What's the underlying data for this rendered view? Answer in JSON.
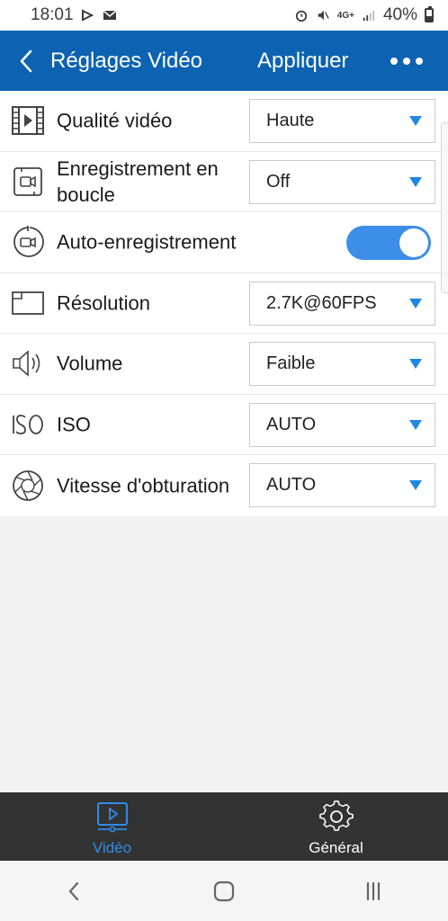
{
  "status_bar": {
    "time": "18:01",
    "battery": "40%",
    "network": "4G+"
  },
  "header": {
    "title": "Réglages Vidéo",
    "apply_label": "Appliquer"
  },
  "settings": [
    {
      "label": "Qualité vidéo",
      "value": "Haute",
      "icon": "film-icon",
      "control": "dropdown"
    },
    {
      "label": "Enregistrement en boucle",
      "value": "Off",
      "icon": "loop-record-icon",
      "control": "dropdown"
    },
    {
      "label": "Auto-enregistrement",
      "value": "on",
      "icon": "auto-record-icon",
      "control": "toggle"
    },
    {
      "label": "Résolution",
      "value": "2.7K@60FPS",
      "icon": "resolution-icon",
      "control": "dropdown"
    },
    {
      "label": "Volume",
      "value": "Faible",
      "icon": "speaker-icon",
      "control": "dropdown"
    },
    {
      "label": "ISO",
      "value": "AUTO",
      "icon": "iso-icon",
      "control": "dropdown"
    },
    {
      "label": "Vitesse d'obturation",
      "value": "AUTO",
      "icon": "shutter-icon",
      "control": "dropdown"
    }
  ],
  "tabs": [
    {
      "label": "Vidéo",
      "icon": "video-tab-icon",
      "active": true
    },
    {
      "label": "Général",
      "icon": "gear-icon",
      "active": false
    }
  ],
  "colors": {
    "header": "#0d63b2",
    "accent": "#2e8de6",
    "toggle_on": "#3d8ee8",
    "tab_bar": "#333333"
  }
}
